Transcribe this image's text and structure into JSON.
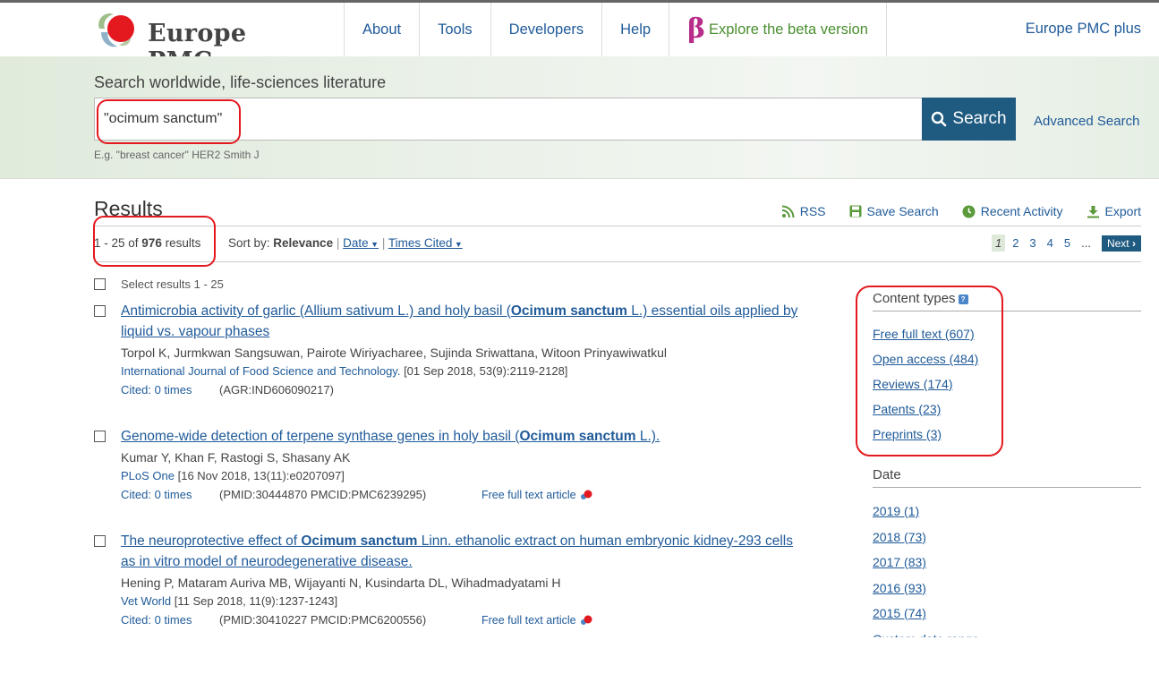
{
  "header": {
    "logo_text": "Europe PMC",
    "nav": [
      "About",
      "Tools",
      "Developers",
      "Help"
    ],
    "beta_symbol": "β",
    "beta_label": "Explore the beta version",
    "plus_label": "Europe PMC plus"
  },
  "search": {
    "heading": "Search worldwide, life-sciences literature",
    "query": "\"ocimum sanctum\"",
    "button": "Search",
    "advanced": "Advanced Search",
    "example": "E.g. \"breast cancer\" HER2 Smith J"
  },
  "results": {
    "heading": "Results",
    "range": "1 - 25 of ",
    "total": "976",
    "suffix": " results",
    "sort_label": "Sort by: ",
    "sort_current": "Relevance",
    "sort_date": "Date",
    "sort_cited": "Times Cited",
    "tools": {
      "rss": "RSS",
      "save": "Save Search",
      "recent": "Recent Activity",
      "export": "Export"
    },
    "pages": [
      "1",
      "2",
      "3",
      "4",
      "5",
      "..."
    ],
    "next": "Next",
    "select_label": "Select results 1 - 25",
    "items": [
      {
        "title_pre": "Antimicrobia activity of garlic (Allium sativum L.) and holy basil (",
        "title_bold": "Ocimum sanctum",
        "title_post": " L.) essential oils applied by liquid vs. vapour phases",
        "authors": "Torpol K, Jurmkwan Sangsuwan, Pairote Wiriyacharee, Sujinda Sriwattana, Witoon Prinyawiwatkul",
        "journal": "International Journal of Food Science and Technology.",
        "citation": " [01 Sep 2018, 53(9):2119-2128]",
        "cited": "Cited: 0 times",
        "ids": "(AGR:IND606090217)",
        "fulltext": ""
      },
      {
        "title_pre": "Genome-wide detection of terpene synthase genes in holy basil (",
        "title_bold": "Ocimum sanctum",
        "title_post": " L.).",
        "authors": "Kumar Y, Khan F, Rastogi S, Shasany AK",
        "journal": "PLoS One",
        "citation": " [16 Nov 2018, 13(11):e0207097]",
        "cited": "Cited: 0 times",
        "ids": "(PMID:30444870 PMCID:PMC6239295)",
        "fulltext": "Free full text article"
      },
      {
        "title_pre": "The neuroprotective effect of ",
        "title_bold": "Ocimum sanctum",
        "title_post": " Linn. ethanolic extract on human embryonic kidney-293 cells as in vitro model of neurodegenerative disease.",
        "authors": "Hening P, Mataram Auriva MB, Wijayanti N, Kusindarta DL, Wihadmadyatami H",
        "journal": "Vet World",
        "citation": " [11 Sep 2018, 11(9):1237-1243]",
        "cited": "Cited: 0 times",
        "ids": "(PMID:30410227 PMCID:PMC6200556)",
        "fulltext": "Free full text article"
      }
    ]
  },
  "sidebar": {
    "content_types_title": "Content types",
    "content_types": [
      "Free full text (607)",
      "Open access (484)",
      "Reviews (174)",
      "Patents (23)",
      "Preprints (3)"
    ],
    "date_title": "Date",
    "dates": [
      "2019 (1)",
      "2018 (73)",
      "2017 (83)",
      "2016 (93)",
      "2015 (74)"
    ],
    "custom_range": "Custom date range"
  },
  "colors": {
    "accent": "#1f5a80",
    "link": "#1f5a99",
    "beta": "#b82c8a",
    "beta_text": "#4a8e2f",
    "annotation": "#e3191f"
  }
}
